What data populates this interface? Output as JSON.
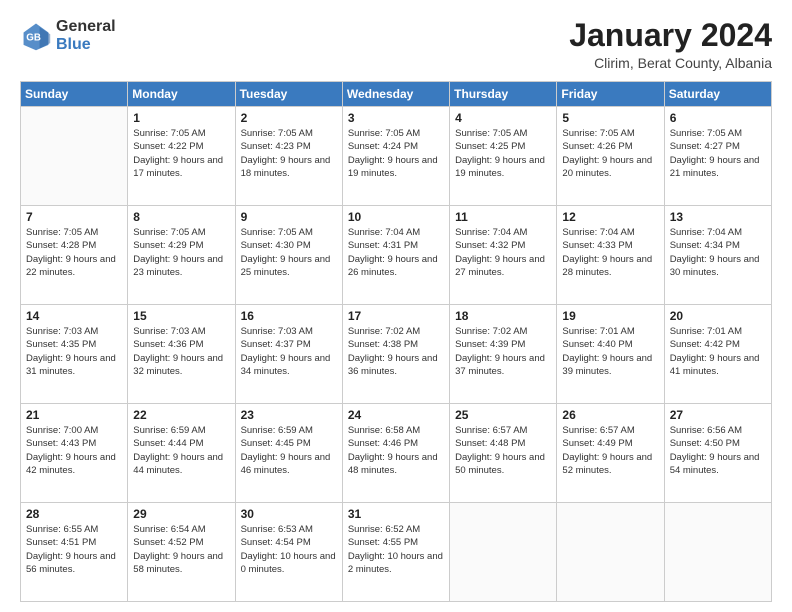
{
  "logo": {
    "general": "General",
    "blue": "Blue"
  },
  "title": {
    "month": "January 2024",
    "location": "Clirim, Berat County, Albania"
  },
  "weekdays": [
    "Sunday",
    "Monday",
    "Tuesday",
    "Wednesday",
    "Thursday",
    "Friday",
    "Saturday"
  ],
  "weeks": [
    [
      {
        "day": "",
        "sunrise": "",
        "sunset": "",
        "daylight": ""
      },
      {
        "day": "1",
        "sunrise": "Sunrise: 7:05 AM",
        "sunset": "Sunset: 4:22 PM",
        "daylight": "Daylight: 9 hours and 17 minutes."
      },
      {
        "day": "2",
        "sunrise": "Sunrise: 7:05 AM",
        "sunset": "Sunset: 4:23 PM",
        "daylight": "Daylight: 9 hours and 18 minutes."
      },
      {
        "day": "3",
        "sunrise": "Sunrise: 7:05 AM",
        "sunset": "Sunset: 4:24 PM",
        "daylight": "Daylight: 9 hours and 19 minutes."
      },
      {
        "day": "4",
        "sunrise": "Sunrise: 7:05 AM",
        "sunset": "Sunset: 4:25 PM",
        "daylight": "Daylight: 9 hours and 19 minutes."
      },
      {
        "day": "5",
        "sunrise": "Sunrise: 7:05 AM",
        "sunset": "Sunset: 4:26 PM",
        "daylight": "Daylight: 9 hours and 20 minutes."
      },
      {
        "day": "6",
        "sunrise": "Sunrise: 7:05 AM",
        "sunset": "Sunset: 4:27 PM",
        "daylight": "Daylight: 9 hours and 21 minutes."
      }
    ],
    [
      {
        "day": "7",
        "sunrise": "Sunrise: 7:05 AM",
        "sunset": "Sunset: 4:28 PM",
        "daylight": "Daylight: 9 hours and 22 minutes."
      },
      {
        "day": "8",
        "sunrise": "Sunrise: 7:05 AM",
        "sunset": "Sunset: 4:29 PM",
        "daylight": "Daylight: 9 hours and 23 minutes."
      },
      {
        "day": "9",
        "sunrise": "Sunrise: 7:05 AM",
        "sunset": "Sunset: 4:30 PM",
        "daylight": "Daylight: 9 hours and 25 minutes."
      },
      {
        "day": "10",
        "sunrise": "Sunrise: 7:04 AM",
        "sunset": "Sunset: 4:31 PM",
        "daylight": "Daylight: 9 hours and 26 minutes."
      },
      {
        "day": "11",
        "sunrise": "Sunrise: 7:04 AM",
        "sunset": "Sunset: 4:32 PM",
        "daylight": "Daylight: 9 hours and 27 minutes."
      },
      {
        "day": "12",
        "sunrise": "Sunrise: 7:04 AM",
        "sunset": "Sunset: 4:33 PM",
        "daylight": "Daylight: 9 hours and 28 minutes."
      },
      {
        "day": "13",
        "sunrise": "Sunrise: 7:04 AM",
        "sunset": "Sunset: 4:34 PM",
        "daylight": "Daylight: 9 hours and 30 minutes."
      }
    ],
    [
      {
        "day": "14",
        "sunrise": "Sunrise: 7:03 AM",
        "sunset": "Sunset: 4:35 PM",
        "daylight": "Daylight: 9 hours and 31 minutes."
      },
      {
        "day": "15",
        "sunrise": "Sunrise: 7:03 AM",
        "sunset": "Sunset: 4:36 PM",
        "daylight": "Daylight: 9 hours and 32 minutes."
      },
      {
        "day": "16",
        "sunrise": "Sunrise: 7:03 AM",
        "sunset": "Sunset: 4:37 PM",
        "daylight": "Daylight: 9 hours and 34 minutes."
      },
      {
        "day": "17",
        "sunrise": "Sunrise: 7:02 AM",
        "sunset": "Sunset: 4:38 PM",
        "daylight": "Daylight: 9 hours and 36 minutes."
      },
      {
        "day": "18",
        "sunrise": "Sunrise: 7:02 AM",
        "sunset": "Sunset: 4:39 PM",
        "daylight": "Daylight: 9 hours and 37 minutes."
      },
      {
        "day": "19",
        "sunrise": "Sunrise: 7:01 AM",
        "sunset": "Sunset: 4:40 PM",
        "daylight": "Daylight: 9 hours and 39 minutes."
      },
      {
        "day": "20",
        "sunrise": "Sunrise: 7:01 AM",
        "sunset": "Sunset: 4:42 PM",
        "daylight": "Daylight: 9 hours and 41 minutes."
      }
    ],
    [
      {
        "day": "21",
        "sunrise": "Sunrise: 7:00 AM",
        "sunset": "Sunset: 4:43 PM",
        "daylight": "Daylight: 9 hours and 42 minutes."
      },
      {
        "day": "22",
        "sunrise": "Sunrise: 6:59 AM",
        "sunset": "Sunset: 4:44 PM",
        "daylight": "Daylight: 9 hours and 44 minutes."
      },
      {
        "day": "23",
        "sunrise": "Sunrise: 6:59 AM",
        "sunset": "Sunset: 4:45 PM",
        "daylight": "Daylight: 9 hours and 46 minutes."
      },
      {
        "day": "24",
        "sunrise": "Sunrise: 6:58 AM",
        "sunset": "Sunset: 4:46 PM",
        "daylight": "Daylight: 9 hours and 48 minutes."
      },
      {
        "day": "25",
        "sunrise": "Sunrise: 6:57 AM",
        "sunset": "Sunset: 4:48 PM",
        "daylight": "Daylight: 9 hours and 50 minutes."
      },
      {
        "day": "26",
        "sunrise": "Sunrise: 6:57 AM",
        "sunset": "Sunset: 4:49 PM",
        "daylight": "Daylight: 9 hours and 52 minutes."
      },
      {
        "day": "27",
        "sunrise": "Sunrise: 6:56 AM",
        "sunset": "Sunset: 4:50 PM",
        "daylight": "Daylight: 9 hours and 54 minutes."
      }
    ],
    [
      {
        "day": "28",
        "sunrise": "Sunrise: 6:55 AM",
        "sunset": "Sunset: 4:51 PM",
        "daylight": "Daylight: 9 hours and 56 minutes."
      },
      {
        "day": "29",
        "sunrise": "Sunrise: 6:54 AM",
        "sunset": "Sunset: 4:52 PM",
        "daylight": "Daylight: 9 hours and 58 minutes."
      },
      {
        "day": "30",
        "sunrise": "Sunrise: 6:53 AM",
        "sunset": "Sunset: 4:54 PM",
        "daylight": "Daylight: 10 hours and 0 minutes."
      },
      {
        "day": "31",
        "sunrise": "Sunrise: 6:52 AM",
        "sunset": "Sunset: 4:55 PM",
        "daylight": "Daylight: 10 hours and 2 minutes."
      },
      {
        "day": "",
        "sunrise": "",
        "sunset": "",
        "daylight": ""
      },
      {
        "day": "",
        "sunrise": "",
        "sunset": "",
        "daylight": ""
      },
      {
        "day": "",
        "sunrise": "",
        "sunset": "",
        "daylight": ""
      }
    ]
  ]
}
